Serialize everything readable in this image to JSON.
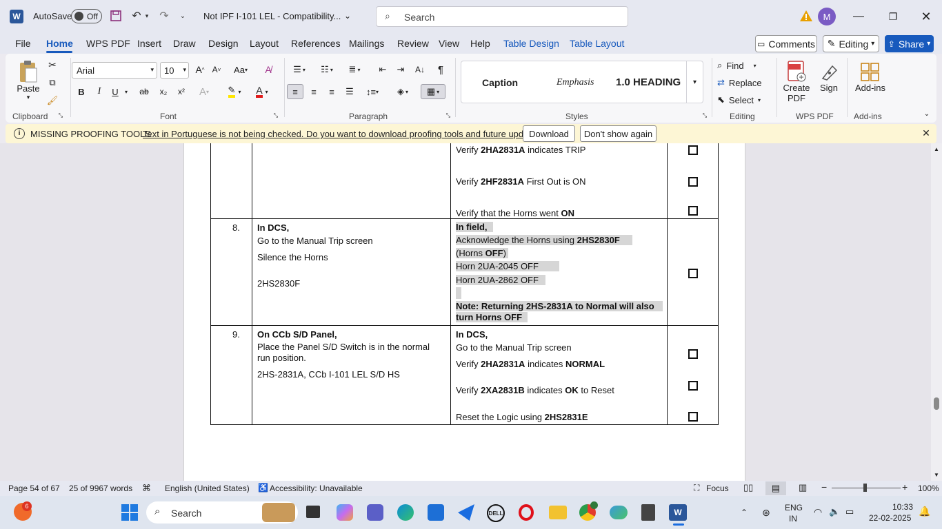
{
  "titlebar": {
    "autosave_label": "AutoSave",
    "autosave_state": "Off",
    "doc_title": "Not IPF I-101 LEL  -  Compatibility...",
    "search_placeholder": "Search",
    "avatar_initial": "M"
  },
  "menu": {
    "tabs": [
      "File",
      "Home",
      "WPS PDF",
      "Insert",
      "Draw",
      "Design",
      "Layout",
      "References",
      "Mailings",
      "Review",
      "View",
      "Help",
      "Table Design",
      "Table Layout"
    ],
    "active": "Home",
    "comments": "Comments",
    "editing": "Editing",
    "share": "Share"
  },
  "ribbon": {
    "paste": "Paste",
    "clipboard": "Clipboard",
    "font_name": "Arial",
    "font_size": "10",
    "font": "Font",
    "paragraph": "Paragraph",
    "styles_label": "Styles",
    "styles": [
      "Caption",
      "Emphasis",
      "1.0  HEADING"
    ],
    "find": "Find",
    "replace": "Replace",
    "select": "Select",
    "editing": "Editing",
    "create_pdf_1": "Create",
    "create_pdf_2": "PDF",
    "sign": "Sign",
    "wps_pdf": "WPS PDF",
    "addins": "Add-ins",
    "addins_group": "Add-ins",
    "bold": "B",
    "italic": "I",
    "underline": "U",
    "strike": "ab",
    "sub": "x₂",
    "sup": "x²",
    "grow": "A^",
    "shrink": "A˅",
    "case": "Aa",
    "pilcrow": "¶"
  },
  "infobar": {
    "title": "MISSING PROOFING TOOLS",
    "message": "Text in Portuguese is not being checked. Do you want to download proofing tools and future updates?",
    "download": "Download",
    "dont_show": "Don't show again"
  },
  "document": {
    "row7_right": [
      {
        "pre": "Verify ",
        "b": "2HA2831A",
        "post": " indicates TRIP"
      },
      {
        "pre": "Verify ",
        "b": "2HF2831A",
        "post": " First Out is ON"
      },
      {
        "pre": "Verify that the Horns went ",
        "b": "ON",
        "post": ""
      }
    ],
    "row8": {
      "num": "8.",
      "left_head": "In DCS,",
      "left_lines": [
        "Go to the Manual Trip screen",
        "Silence the Horns",
        "2HS2830F"
      ],
      "right_head": "In field,",
      "right_l1_pre": "Acknowledge the Horns using ",
      "right_l1_b": "2HS2830F",
      "right_l2_pre": "(Horns ",
      "right_l2_b": "OFF",
      "right_l2_post": ")",
      "right_l3": "Horn 2UA-2045 OFF",
      "right_l4": "Horn 2UA-2862 OFF",
      "note_1": "Note: Returning 2HS-2831A to Normal will also",
      "note_2": "turn Horns OFF"
    },
    "row9": {
      "num": "9.",
      "left_head": "On CCb S/D Panel,",
      "left_l1": "Place the Panel S/D Switch is in the normal",
      "left_l2": "run position.",
      "left_l3": "2HS-2831A, CCb I-101 LEL S/D HS",
      "right_head": "In DCS,",
      "right_l1": "Go to the Manual Trip screen",
      "right_l2_pre": "Verify ",
      "right_l2_b": "2HA2831A",
      "right_l2_mid": " indicates ",
      "right_l2_b2": "NORMAL",
      "right_l3_pre": "Verify ",
      "right_l3_b": "2XA2831B",
      "right_l3_mid": " indicates ",
      "right_l3_b2": "OK",
      "right_l3_post": " to Reset",
      "right_l4_pre": "Reset the Logic using ",
      "right_l4_b": "2HS2831E"
    }
  },
  "status": {
    "page": "Page 54 of 67",
    "words": "25 of 9967 words",
    "language": "English (United States)",
    "accessibility": "Accessibility: Unavailable",
    "focus": "Focus",
    "zoom": "100%"
  },
  "taskbar": {
    "badge": "6",
    "search": "Search",
    "lang1": "ENG",
    "lang2": "IN",
    "time": "10:33",
    "date": "22-02-2025"
  },
  "colors": {
    "accent": "#185abd",
    "word_blue": "#2b579a",
    "highlight": "#d6d6d6",
    "warning": "#e8a000"
  }
}
